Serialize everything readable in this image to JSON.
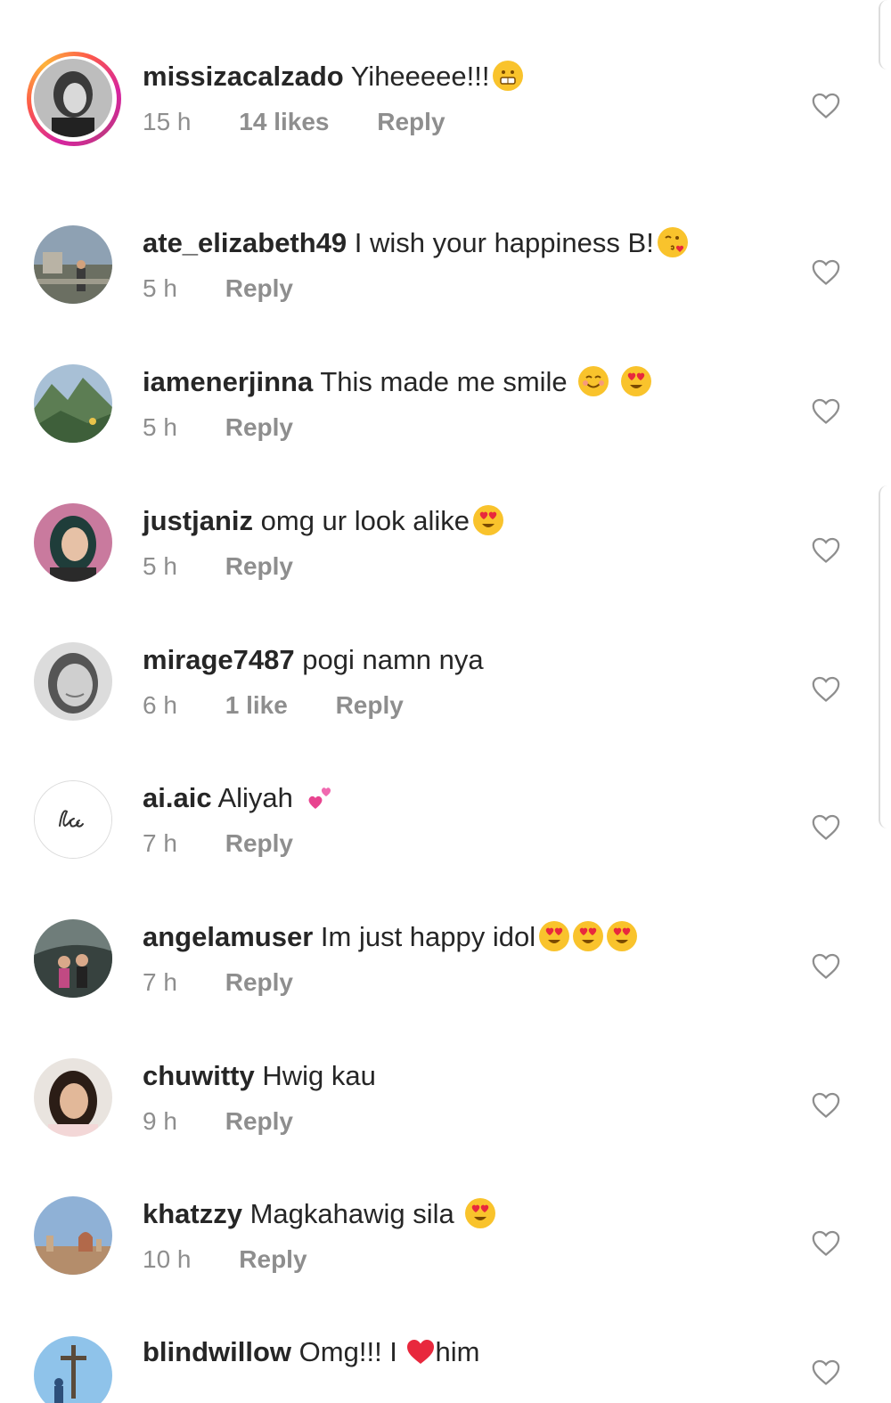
{
  "colors": {
    "username": "#262626",
    "meta": "#8e8e8e",
    "heart_outline": "#8e8e8e",
    "emoji_yellow": "#f9c32c",
    "heart_red": "#e8283d"
  },
  "comments": [
    {
      "username": "missizacalzado",
      "text": "Yiheeeee!!!",
      "emojis": [
        "grimacing-face"
      ],
      "time": "15 h",
      "likes": "14 likes",
      "reply": "Reply",
      "avatar": "story-ring-avatar"
    },
    {
      "username": "ate_elizabeth49",
      "text": "I wish your happiness B!",
      "emojis": [
        "face-blowing-kiss"
      ],
      "time": "5 h",
      "likes": "",
      "reply": "Reply",
      "avatar": "street-photo-avatar"
    },
    {
      "username": "iamenerjinna",
      "text": "This made me smile",
      "emojis": [
        "smiling-face",
        "heart-eyes-face"
      ],
      "time": "5 h",
      "likes": "",
      "reply": "Reply",
      "avatar": "landscape-avatar"
    },
    {
      "username": "justjaniz",
      "text": "omg ur look alike",
      "emojis": [
        "heart-eyes-face"
      ],
      "time": "5 h",
      "likes": "",
      "reply": "Reply",
      "avatar": "portrait-avatar"
    },
    {
      "username": "mirage7487",
      "text": "pogi namn nya",
      "emojis": [],
      "time": "6 h",
      "likes": "1 like",
      "reply": "Reply",
      "avatar": "bw-portrait-avatar"
    },
    {
      "username": "ai.aic",
      "text": "Aliyah",
      "emojis": [
        "two-hearts"
      ],
      "time": "7 h",
      "likes": "",
      "reply": "Reply",
      "avatar": "logo-avatar"
    },
    {
      "username": "angelamuser",
      "text": "Im just happy idol",
      "emojis": [
        "heart-eyes-face",
        "heart-eyes-face",
        "heart-eyes-face"
      ],
      "time": "7 h",
      "likes": "",
      "reply": "Reply",
      "avatar": "group-photo-avatar"
    },
    {
      "username": "chuwitty",
      "text": "Hwig kau",
      "emojis": [],
      "time": "9 h",
      "likes": "",
      "reply": "Reply",
      "avatar": "selfie-avatar"
    },
    {
      "username": "khatzzy",
      "text": "Magkahawig sila",
      "emojis": [
        "heart-eyes-face"
      ],
      "time": "10 h",
      "likes": "",
      "reply": "Reply",
      "avatar": "city-skyline-avatar"
    },
    {
      "username": "blindwillow",
      "text": "Omg!!! I",
      "text_after": "him",
      "emojis": [
        "red-heart"
      ],
      "time": "",
      "likes": "",
      "reply": "",
      "avatar": "cross-sky-avatar"
    }
  ]
}
